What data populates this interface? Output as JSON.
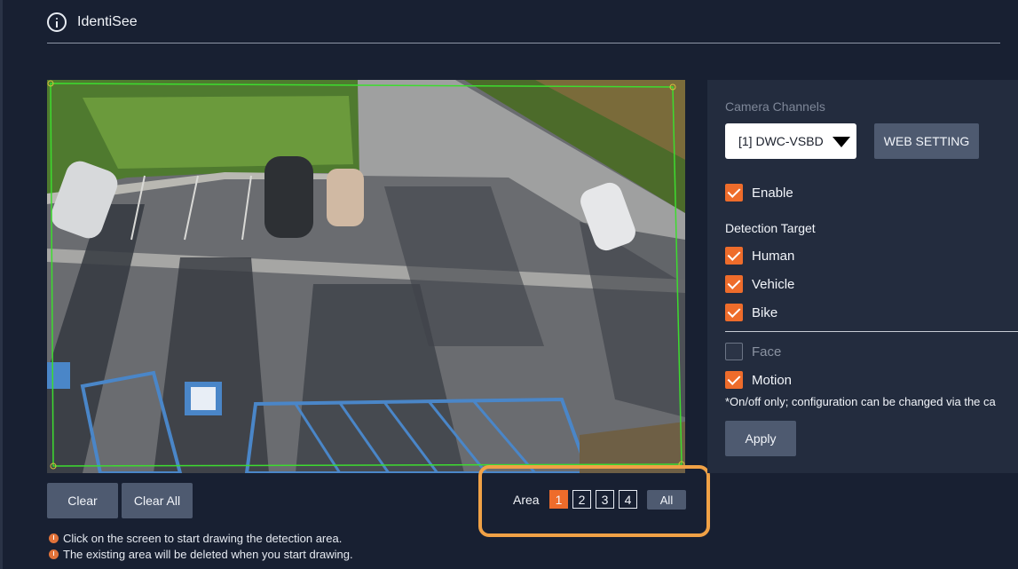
{
  "app": {
    "title": "IdentiSee"
  },
  "camera": {
    "area_controls": {
      "label": "Area",
      "numbers": [
        "1",
        "2",
        "3",
        "4"
      ],
      "selected": "1",
      "all_label": "All"
    },
    "clear_label": "Clear",
    "clear_all_label": "Clear All",
    "tips": [
      "Click on the screen to start drawing the detection area.",
      "The existing area will be deleted when you start drawing."
    ]
  },
  "panel": {
    "camera_channels_label": "Camera Channels",
    "channel_selected": "[1] DWC-VSBD",
    "web_setting_label": "WEB SETTING",
    "enable": {
      "label": "Enable",
      "checked": true
    },
    "detection_target_label": "Detection Target",
    "targets": [
      {
        "label": "Human",
        "checked": true
      },
      {
        "label": "Vehicle",
        "checked": true
      },
      {
        "label": "Bike",
        "checked": true
      }
    ],
    "face": {
      "label": "Face",
      "checked": false
    },
    "motion": {
      "label": "Motion",
      "checked": true
    },
    "note": "*On/off only; configuration can be changed via the ca",
    "apply_label": "Apply"
  },
  "colors": {
    "accent": "#ee6c2b",
    "highlight_box": "#f0a146",
    "detection_polygon": "#3ddc2f",
    "background": "#182032",
    "panel": "#232c3e",
    "button": "#4e5a70"
  }
}
